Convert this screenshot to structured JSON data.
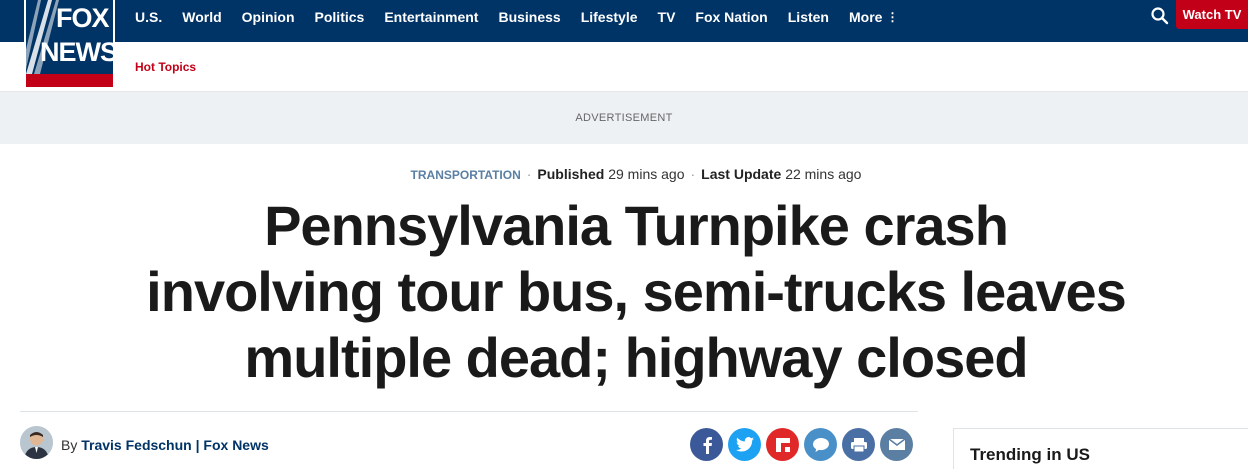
{
  "brand": {
    "logo_top": "FOX",
    "logo_bottom": "NEWS"
  },
  "nav": {
    "items": [
      "U.S.",
      "World",
      "Opinion",
      "Politics",
      "Entertainment",
      "Business",
      "Lifestyle",
      "TV",
      "Fox Nation",
      "Listen"
    ],
    "more_label": "More",
    "watch_label": "Watch TV",
    "hot_topics_label": "Hot Topics"
  },
  "ad_label": "ADVERTISEMENT",
  "article": {
    "category": "TRANSPORTATION",
    "published_label": "Published",
    "published_time": "29 mins ago",
    "updated_label": "Last Update",
    "updated_time": "22 mins ago",
    "headline_lines": [
      "Pennsylvania Turnpike crash",
      "involving tour bus, semi-trucks leaves",
      "multiple dead; highway closed"
    ],
    "byline_prefix": "By",
    "author": "Travis Fedschun",
    "separator": "|",
    "outlet": "Fox News"
  },
  "share_buttons": [
    {
      "icon": "facebook-icon",
      "color": "#3b5998"
    },
    {
      "icon": "twitter-icon",
      "color": "#1da1f2"
    },
    {
      "icon": "flipboard-icon",
      "color": "#e12828"
    },
    {
      "icon": "comments-icon",
      "color": "#4a90c8"
    },
    {
      "icon": "print-icon",
      "color": "#4a6fa5"
    },
    {
      "icon": "email-icon",
      "color": "#5a7fa3"
    }
  ],
  "sidebar": {
    "trending_title": "Trending in US"
  },
  "colors": {
    "nav_bg": "#003366",
    "accent_red": "#c20017",
    "category_blue": "#5a7fa3"
  }
}
